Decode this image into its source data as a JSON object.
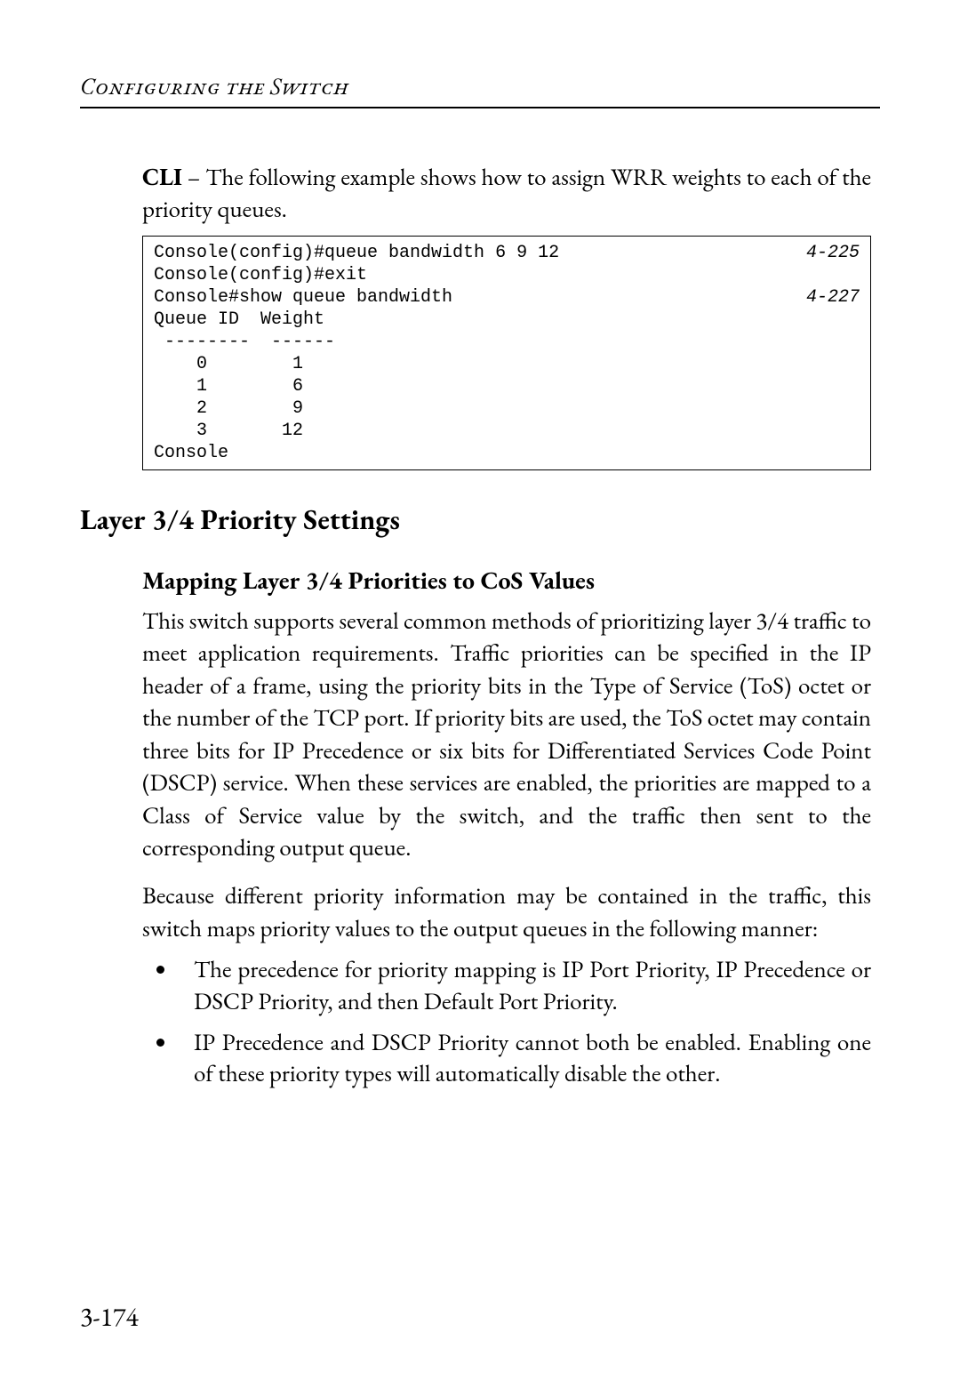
{
  "running_head": "Configuring the Switch",
  "intro": {
    "cli_label": "CLI",
    "intro_text": " – The following example shows how to assign WRR weights to each of the priority queues."
  },
  "code": {
    "lines": [
      {
        "text": "Console(config)#queue bandwidth 6 9 12",
        "ref": "4-225"
      },
      {
        "text": "Console(config)#exit",
        "ref": ""
      },
      {
        "text": "Console#show queue bandwidth",
        "ref": "4-227"
      },
      {
        "text": "Queue ID  Weight",
        "ref": ""
      },
      {
        "text": " --------  ------",
        "ref": ""
      },
      {
        "text": "    0        1",
        "ref": ""
      },
      {
        "text": "    1        6",
        "ref": ""
      },
      {
        "text": "    2        9",
        "ref": ""
      },
      {
        "text": "    3       12",
        "ref": ""
      },
      {
        "text": "Console",
        "ref": ""
      }
    ]
  },
  "h2": "Layer 3/4 Priority Settings",
  "h3": "Mapping Layer 3/4 Priorities to CoS Values",
  "para1": "This switch supports several common methods of prioritizing layer 3/4 traffic to meet application requirements. Traffic priorities can be specified in the IP header of a frame, using the priority bits in the Type of Service (ToS) octet or the number of the TCP port. If priority bits are used, the ToS octet may contain three bits for IP Precedence or six bits for Differentiated Services Code Point (DSCP) service. When these services are enabled, the priorities are mapped to a Class of Service value by the switch, and the traffic then sent to the corresponding output queue.",
  "para2": "Because different priority information may be contained in the traffic, this switch maps priority values to the output queues in the following manner:",
  "bullets": [
    "The precedence for priority mapping is IP Port Priority, IP Precedence or DSCP Priority, and then Default Port Priority.",
    "IP Precedence and DSCP Priority cannot both be enabled. Enabling one of these priority types will automatically disable the other."
  ],
  "page_number": "3-174"
}
